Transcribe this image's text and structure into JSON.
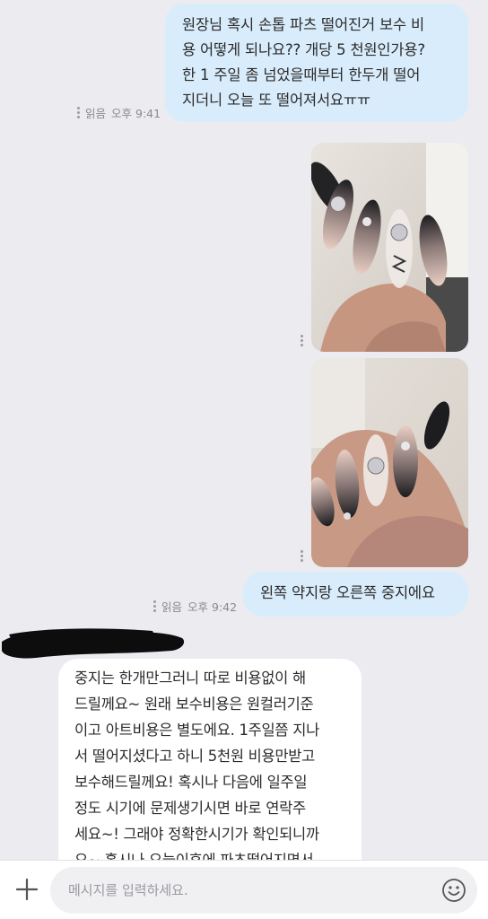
{
  "messages": {
    "m1": {
      "lines": [
        "원장님 혹시 손톱 파츠 떨어진거 보수 비",
        "용 어떻게 되나요?? 개당 5 천원인가용?",
        "한 1 주일 좀 넘었을때부터 한두개 떨어",
        "지더니 오늘 또 떨어져서요ㅠㅠ"
      ],
      "status": "읽음",
      "time": "오후 9:41"
    },
    "m4": {
      "text": "왼쪽 약지랑 오른쪽 중지에요",
      "status": "읽음",
      "time": "오후 9:42"
    },
    "m5": {
      "lines": [
        "중지는 한개만그러니 따로 비용없이 해",
        "드릴께요~ 원래 보수비용은 원컬러기준",
        "이고 아트비용은 별도에요. 1주일쯤 지나",
        "서 떨어지셨다고 하니 5천원 비용만받고",
        "보수해드릴께요! 혹시나 다음에 일주일",
        "정도 시기에 문제생기시면 바로 연락주",
        "세요~! 그래야 정확한시기가 확인되니까",
        "요~ 혹시나 오늘이후에 파츠떨어지면서"
      ]
    }
  },
  "photos": [
    {
      "subject": "nail-art-photo-1"
    },
    {
      "subject": "nail-art-photo-2"
    }
  ],
  "input": {
    "placeholder": "메시지를 입력하세요."
  },
  "icons": {
    "plus": "plus-icon",
    "emoji": "smiley-face-icon"
  },
  "colors": {
    "outgoing_bubble": "#d9ecfb",
    "incoming_bubble": "#ffffff",
    "background": "#ebebf0"
  }
}
